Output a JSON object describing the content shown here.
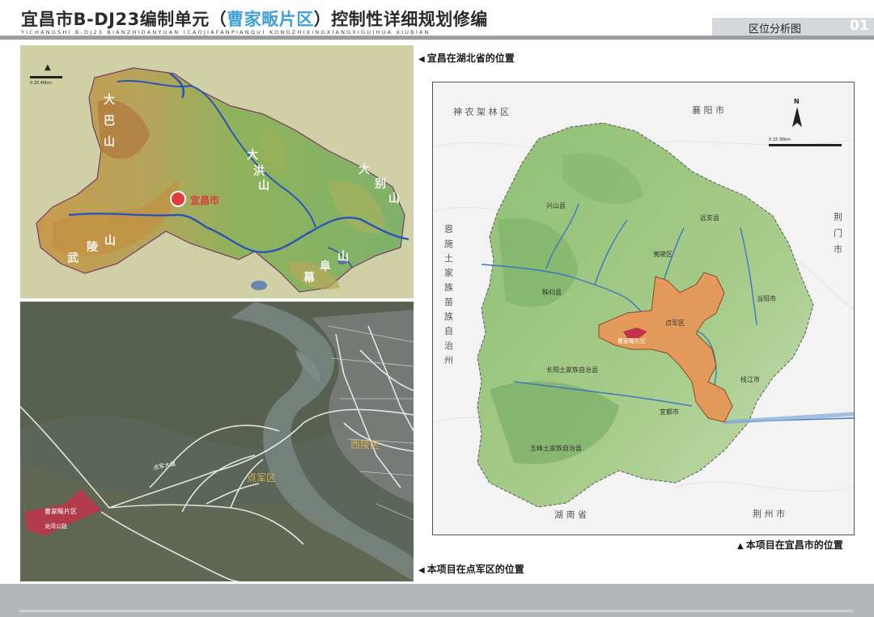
{
  "header": {
    "title_prefix": "宜昌市B-DJ23编制单元（",
    "title_highlight": "曹家畈片区",
    "title_suffix": "）控制性详细规划修编",
    "pinyin": "YICHANGSHI B-DJ23 BIANZHIDANYUAN (CAOJIAFANPIANQU) KONGZHIXINGXIANGXIGUIHUA XIUBIAN",
    "tab_label": "区位分析图",
    "page_number": "01"
  },
  "captions": {
    "hubei": "宜昌在湖北省的位置",
    "yichang": "本项目在宜昌市的位置",
    "dianjun": "本项目在点军区的位置"
  },
  "hubei_map": {
    "marker_label": "宜昌市",
    "mountains": [
      "大巴山",
      "武陵山",
      "大洪山",
      "大别山",
      "幕阜山"
    ],
    "mountain_chars": {
      "daba": [
        "大",
        "巴",
        "山"
      ],
      "wuling": [
        "武",
        "陵",
        "山"
      ],
      "dahong": [
        "大",
        "洪",
        "山"
      ],
      "dabie": [
        "大",
        "别",
        "山"
      ],
      "mufu": [
        "幕",
        "阜",
        "山"
      ]
    },
    "scale_label": "0  20  40km"
  },
  "yichang_map": {
    "border_labels": {
      "shennongjia": "神 农 架 林 区",
      "xiangyang": "襄 阳 市",
      "jingmen": [
        "荆",
        "门",
        "市"
      ],
      "enshi": [
        "恩",
        "施",
        "土",
        "家",
        "族",
        "苗",
        "族",
        "自",
        "治",
        "州"
      ],
      "hunan": "湖 南 省",
      "jingzhou": "荆 州 市"
    },
    "place_labels": [
      "兴山县",
      "秭归县",
      "远安县",
      "夷陵区",
      "当阳市",
      "长阳土家族自治县",
      "五峰土家族自治县",
      "宜都市",
      "枝江市",
      "点军区"
    ],
    "project_label": "曹家畈片区",
    "north": "N",
    "scale_label": "0   15   30km"
  },
  "dianjun_map": {
    "project_label": "曹家畈片区",
    "road_labels": [
      "点军大道",
      "龙湾公路"
    ],
    "district_labels": [
      "点军区",
      "西陵区"
    ]
  },
  "colors": {
    "title_highlight": "#3f9fd8",
    "project_red": "#c0334a",
    "project_orange": "#e39a5a",
    "river_blue": "#2a55b8",
    "marker_red": "#e03a3a"
  }
}
